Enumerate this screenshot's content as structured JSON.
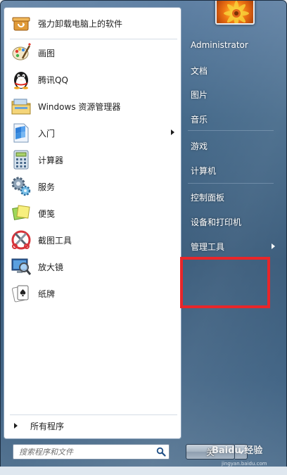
{
  "pinned_items": [
    {
      "label": "强力卸载电脑上的软件",
      "icon": "uninstall-box-icon",
      "has_submenu": false
    },
    {
      "label": "画图",
      "icon": "paint-palette-icon",
      "has_submenu": false
    },
    {
      "label": "腾讯QQ",
      "icon": "qq-penguin-icon",
      "has_submenu": false
    },
    {
      "label": "Windows 资源管理器",
      "icon": "explorer-folder-icon",
      "has_submenu": false
    },
    {
      "label": "入门",
      "icon": "getting-started-icon",
      "has_submenu": true
    },
    {
      "label": "计算器",
      "icon": "calculator-icon",
      "has_submenu": false
    },
    {
      "label": "服务",
      "icon": "services-gear-icon",
      "has_submenu": false
    },
    {
      "label": "便笺",
      "icon": "sticky-notes-icon",
      "has_submenu": false
    },
    {
      "label": "截图工具",
      "icon": "snipping-tool-icon",
      "has_submenu": false
    },
    {
      "label": "放大镜",
      "icon": "magnifier-icon",
      "has_submenu": false
    },
    {
      "label": "纸牌",
      "icon": "solitaire-card-icon",
      "has_submenu": false
    }
  ],
  "all_programs_label": "所有程序",
  "search": {
    "placeholder": "搜索程序和文件"
  },
  "right_items": [
    {
      "label": "Administrator",
      "has_submenu": false
    },
    {
      "label": "文档",
      "has_submenu": false
    },
    {
      "label": "图片",
      "has_submenu": false
    },
    {
      "label": "音乐",
      "has_submenu": false
    },
    {
      "label": "游戏",
      "has_submenu": false
    },
    {
      "label": "计算机",
      "has_submenu": false
    },
    {
      "label": "控制面板",
      "has_submenu": false
    },
    {
      "label": "设备和打印机",
      "has_submenu": false
    },
    {
      "label": "管理工具",
      "has_submenu": true
    }
  ],
  "shutdown": {
    "label": "关"
  },
  "watermark": {
    "main": "Baidu 经验",
    "sub": "jingyan.baidu.com"
  },
  "colors": {
    "highlight_box": "#e8262a",
    "menu_glass": "#2f5273",
    "panel_bg": "#ffffff"
  }
}
